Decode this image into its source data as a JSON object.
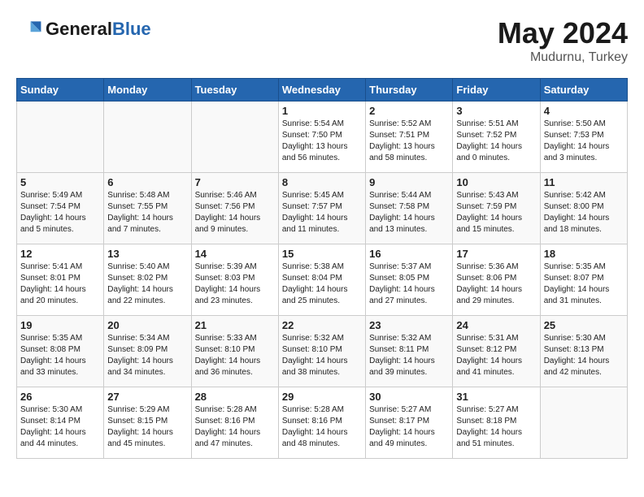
{
  "header": {
    "logo_general": "General",
    "logo_blue": "Blue",
    "title": "May 2024",
    "subtitle": "Mudurnu, Turkey"
  },
  "days_of_week": [
    "Sunday",
    "Monday",
    "Tuesday",
    "Wednesday",
    "Thursday",
    "Friday",
    "Saturday"
  ],
  "weeks": [
    [
      {
        "num": "",
        "info": ""
      },
      {
        "num": "",
        "info": ""
      },
      {
        "num": "",
        "info": ""
      },
      {
        "num": "1",
        "info": "Sunrise: 5:54 AM\nSunset: 7:50 PM\nDaylight: 13 hours\nand 56 minutes."
      },
      {
        "num": "2",
        "info": "Sunrise: 5:52 AM\nSunset: 7:51 PM\nDaylight: 13 hours\nand 58 minutes."
      },
      {
        "num": "3",
        "info": "Sunrise: 5:51 AM\nSunset: 7:52 PM\nDaylight: 14 hours\nand 0 minutes."
      },
      {
        "num": "4",
        "info": "Sunrise: 5:50 AM\nSunset: 7:53 PM\nDaylight: 14 hours\nand 3 minutes."
      }
    ],
    [
      {
        "num": "5",
        "info": "Sunrise: 5:49 AM\nSunset: 7:54 PM\nDaylight: 14 hours\nand 5 minutes."
      },
      {
        "num": "6",
        "info": "Sunrise: 5:48 AM\nSunset: 7:55 PM\nDaylight: 14 hours\nand 7 minutes."
      },
      {
        "num": "7",
        "info": "Sunrise: 5:46 AM\nSunset: 7:56 PM\nDaylight: 14 hours\nand 9 minutes."
      },
      {
        "num": "8",
        "info": "Sunrise: 5:45 AM\nSunset: 7:57 PM\nDaylight: 14 hours\nand 11 minutes."
      },
      {
        "num": "9",
        "info": "Sunrise: 5:44 AM\nSunset: 7:58 PM\nDaylight: 14 hours\nand 13 minutes."
      },
      {
        "num": "10",
        "info": "Sunrise: 5:43 AM\nSunset: 7:59 PM\nDaylight: 14 hours\nand 15 minutes."
      },
      {
        "num": "11",
        "info": "Sunrise: 5:42 AM\nSunset: 8:00 PM\nDaylight: 14 hours\nand 18 minutes."
      }
    ],
    [
      {
        "num": "12",
        "info": "Sunrise: 5:41 AM\nSunset: 8:01 PM\nDaylight: 14 hours\nand 20 minutes."
      },
      {
        "num": "13",
        "info": "Sunrise: 5:40 AM\nSunset: 8:02 PM\nDaylight: 14 hours\nand 22 minutes."
      },
      {
        "num": "14",
        "info": "Sunrise: 5:39 AM\nSunset: 8:03 PM\nDaylight: 14 hours\nand 23 minutes."
      },
      {
        "num": "15",
        "info": "Sunrise: 5:38 AM\nSunset: 8:04 PM\nDaylight: 14 hours\nand 25 minutes."
      },
      {
        "num": "16",
        "info": "Sunrise: 5:37 AM\nSunset: 8:05 PM\nDaylight: 14 hours\nand 27 minutes."
      },
      {
        "num": "17",
        "info": "Sunrise: 5:36 AM\nSunset: 8:06 PM\nDaylight: 14 hours\nand 29 minutes."
      },
      {
        "num": "18",
        "info": "Sunrise: 5:35 AM\nSunset: 8:07 PM\nDaylight: 14 hours\nand 31 minutes."
      }
    ],
    [
      {
        "num": "19",
        "info": "Sunrise: 5:35 AM\nSunset: 8:08 PM\nDaylight: 14 hours\nand 33 minutes."
      },
      {
        "num": "20",
        "info": "Sunrise: 5:34 AM\nSunset: 8:09 PM\nDaylight: 14 hours\nand 34 minutes."
      },
      {
        "num": "21",
        "info": "Sunrise: 5:33 AM\nSunset: 8:10 PM\nDaylight: 14 hours\nand 36 minutes."
      },
      {
        "num": "22",
        "info": "Sunrise: 5:32 AM\nSunset: 8:10 PM\nDaylight: 14 hours\nand 38 minutes."
      },
      {
        "num": "23",
        "info": "Sunrise: 5:32 AM\nSunset: 8:11 PM\nDaylight: 14 hours\nand 39 minutes."
      },
      {
        "num": "24",
        "info": "Sunrise: 5:31 AM\nSunset: 8:12 PM\nDaylight: 14 hours\nand 41 minutes."
      },
      {
        "num": "25",
        "info": "Sunrise: 5:30 AM\nSunset: 8:13 PM\nDaylight: 14 hours\nand 42 minutes."
      }
    ],
    [
      {
        "num": "26",
        "info": "Sunrise: 5:30 AM\nSunset: 8:14 PM\nDaylight: 14 hours\nand 44 minutes."
      },
      {
        "num": "27",
        "info": "Sunrise: 5:29 AM\nSunset: 8:15 PM\nDaylight: 14 hours\nand 45 minutes."
      },
      {
        "num": "28",
        "info": "Sunrise: 5:28 AM\nSunset: 8:16 PM\nDaylight: 14 hours\nand 47 minutes."
      },
      {
        "num": "29",
        "info": "Sunrise: 5:28 AM\nSunset: 8:16 PM\nDaylight: 14 hours\nand 48 minutes."
      },
      {
        "num": "30",
        "info": "Sunrise: 5:27 AM\nSunset: 8:17 PM\nDaylight: 14 hours\nand 49 minutes."
      },
      {
        "num": "31",
        "info": "Sunrise: 5:27 AM\nSunset: 8:18 PM\nDaylight: 14 hours\nand 51 minutes."
      },
      {
        "num": "",
        "info": ""
      }
    ]
  ]
}
